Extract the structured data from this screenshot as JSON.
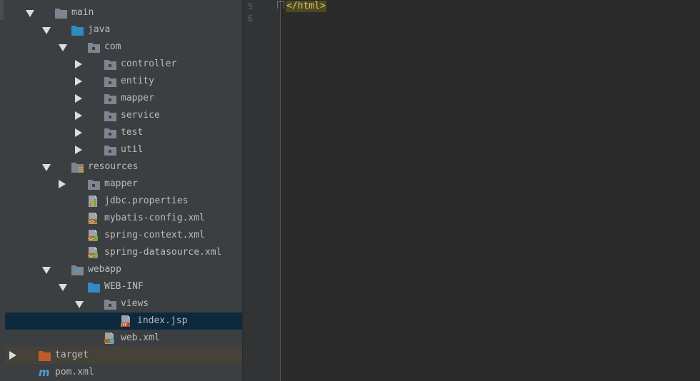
{
  "tree": [
    {
      "label": "main",
      "depth": 0,
      "arrow": "down",
      "icon": "folder-gray"
    },
    {
      "label": "java",
      "depth": 1,
      "arrow": "down",
      "icon": "folder-blue"
    },
    {
      "label": "com",
      "depth": 2,
      "arrow": "down",
      "icon": "folder-package"
    },
    {
      "label": "controller",
      "depth": 3,
      "arrow": "right",
      "icon": "folder-package"
    },
    {
      "label": "entity",
      "depth": 3,
      "arrow": "right",
      "icon": "folder-package"
    },
    {
      "label": "mapper",
      "depth": 3,
      "arrow": "right",
      "icon": "folder-package"
    },
    {
      "label": "service",
      "depth": 3,
      "arrow": "right",
      "icon": "folder-package"
    },
    {
      "label": "test",
      "depth": 3,
      "arrow": "right",
      "icon": "folder-package"
    },
    {
      "label": "util",
      "depth": 3,
      "arrow": "right",
      "icon": "folder-package"
    },
    {
      "label": "resources",
      "depth": 1,
      "arrow": "down",
      "icon": "folder-resources"
    },
    {
      "label": "mapper",
      "depth": 2,
      "arrow": "right",
      "icon": "folder-package"
    },
    {
      "label": "jdbc.properties",
      "depth": 2,
      "arrow": "none",
      "icon": "file-properties"
    },
    {
      "label": "mybatis-config.xml",
      "depth": 2,
      "arrow": "none",
      "icon": "file-xml"
    },
    {
      "label": "spring-context.xml",
      "depth": 2,
      "arrow": "none",
      "icon": "file-spring-xml"
    },
    {
      "label": "spring-datasource.xml",
      "depth": 2,
      "arrow": "none",
      "icon": "file-spring-xml"
    },
    {
      "label": "webapp",
      "depth": 1,
      "arrow": "down",
      "icon": "folder-web"
    },
    {
      "label": "WEB-INF",
      "depth": 2,
      "arrow": "down",
      "icon": "folder-blue"
    },
    {
      "label": "views",
      "depth": 3,
      "arrow": "down",
      "icon": "folder-package"
    },
    {
      "label": "index.jsp",
      "depth": 4,
      "arrow": "none",
      "icon": "file-jsp",
      "selected": true
    },
    {
      "label": "web.xml",
      "depth": 3,
      "arrow": "none",
      "icon": "file-webxml"
    },
    {
      "label": "target",
      "depth": -1,
      "arrow": "right",
      "icon": "folder-orange",
      "highlight": true
    },
    {
      "label": "pom.xml",
      "depth": -1,
      "arrow": "none",
      "icon": "file-maven"
    }
  ],
  "editor": {
    "lines": [
      {
        "number": "5",
        "code": "</html>"
      },
      {
        "number": "6",
        "code": ""
      }
    ]
  }
}
